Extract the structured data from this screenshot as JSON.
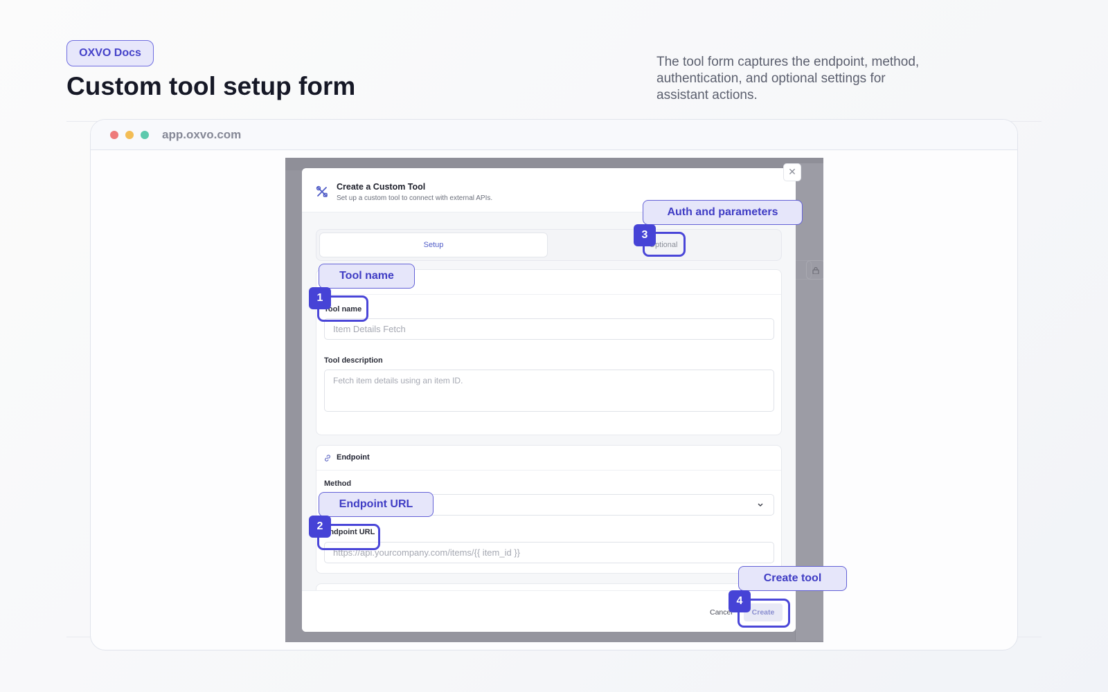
{
  "docs": {
    "badge": "OXVO Docs",
    "title": "Custom tool setup form",
    "description": "The tool form captures the endpoint, method, authentication, and optional settings for assistant actions."
  },
  "browser": {
    "url": "app.oxvo.com",
    "dot_colors": [
      "#ee7a7a",
      "#f3bd55",
      "#5cc9ad"
    ]
  },
  "modal": {
    "title": "Create a Custom Tool",
    "subtitle": "Set up a custom tool to connect with external APIs.",
    "tabs": [
      {
        "label": "Setup",
        "active": true
      },
      {
        "label": "Optional",
        "active": false
      }
    ],
    "details": {
      "tool_name_label": "Tool name",
      "tool_name_placeholder": "Item Details Fetch",
      "tool_description_label": "Tool description",
      "tool_description_placeholder": "Fetch item details using an item ID."
    },
    "endpoint": {
      "section_label": "Endpoint",
      "method_label": "Method",
      "method_value": "",
      "url_label": "Endpoint URL",
      "url_placeholder": "https://api.yourcompany.com/items/{{ item_id }}"
    },
    "footer": {
      "cancel_label": "Cancel",
      "create_label": "Create"
    }
  },
  "callouts": [
    {
      "number": "1",
      "label": "Tool name"
    },
    {
      "number": "2",
      "label": "Endpoint URL"
    },
    {
      "number": "3",
      "label": "Auth and parameters"
    },
    {
      "number": "4",
      "label": "Create tool"
    }
  ],
  "colors": {
    "accent": "#4643d6",
    "callout_fill": "#e6e6fa",
    "overlay": "#95959e"
  }
}
